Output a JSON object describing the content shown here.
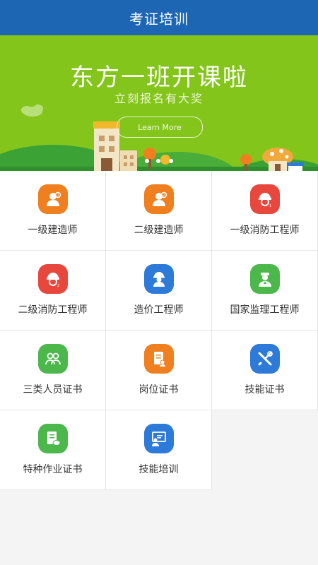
{
  "header": {
    "title": "考证培训"
  },
  "banner": {
    "title": "东方一班开课啦",
    "subtitle": "立刻报名有大奖",
    "button_label": "Learn More"
  },
  "grid": {
    "items": [
      {
        "label": "一级建造师",
        "icon": "builder-icon",
        "color": "#f07f1f"
      },
      {
        "label": "二级建造师",
        "icon": "builder-icon",
        "color": "#f07f1f"
      },
      {
        "label": "一级消防工程师",
        "icon": "firefighter-icon",
        "color": "#e8473d"
      },
      {
        "label": "二级消防工程师",
        "icon": "firefighter-icon",
        "color": "#e8473d"
      },
      {
        "label": "造价工程师",
        "icon": "hardhat-worker-icon",
        "color": "#2d7ad9"
      },
      {
        "label": "国家监理工程师",
        "icon": "inspector-icon",
        "color": "#4cb84c"
      },
      {
        "label": "三类人员证书",
        "icon": "people-group-icon",
        "color": "#4cb84c"
      },
      {
        "label": "岗位证书",
        "icon": "document-icon",
        "color": "#f07f1f"
      },
      {
        "label": "技能证书",
        "icon": "tools-icon",
        "color": "#2d7ad9"
      },
      {
        "label": "特种作业证书",
        "icon": "certificate-doc-icon",
        "color": "#4cb84c"
      },
      {
        "label": "技能培训",
        "icon": "training-board-icon",
        "color": "#2d7ad9"
      }
    ]
  }
}
